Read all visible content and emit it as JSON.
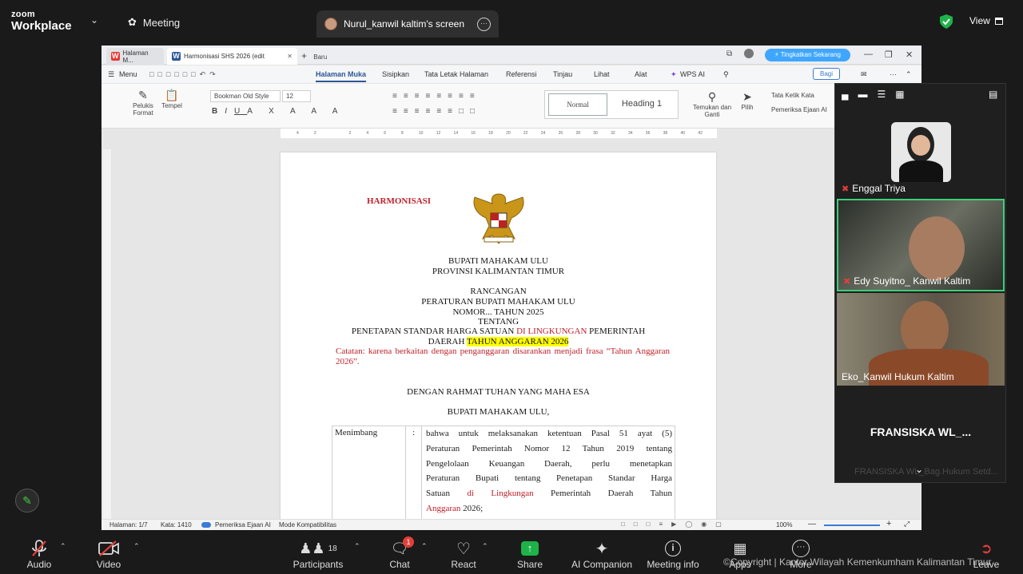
{
  "zoom": {
    "logo_line1": "zoom",
    "logo_line2": "Workplace",
    "meeting_label": "Meeting",
    "share_tab_label": "Nurul_kanwil kaltim's screen",
    "view_label": "View"
  },
  "wps": {
    "tabs": [
      {
        "label": "Halaman M..."
      },
      {
        "label": "Harmonisasi SHS 2026 (edit"
      }
    ],
    "new_tab": "Baru",
    "upgrade": "Tingkatkan Sekarang",
    "menu_label": "Menu",
    "menu_items": [
      "Halaman Muka",
      "Sisipkan",
      "Tata Letak Halaman",
      "Referensi",
      "Tinjau",
      "Lihat",
      "Alat",
      "WPS AI"
    ],
    "share_button": "Bagi",
    "ribbon": {
      "pelukis": "Pelukis",
      "format": "Format",
      "tempel": "Tempel",
      "font": "Bookman Old Style",
      "size": "12",
      "style_normal": "Normal",
      "style_heading": "Heading 1",
      "temukan": "Temukan dan",
      "ganti": "Ganti",
      "pilih": "Pilih",
      "tata_ketik": "Tata Ketik Kata",
      "pemeriksa": "Pemeriksa Ejaan AI"
    },
    "ruler_ticks": [
      "4",
      "2",
      "",
      "2",
      "4",
      "6",
      "8",
      "10",
      "12",
      "14",
      "16",
      "18",
      "20",
      "22",
      "24",
      "26",
      "28",
      "30",
      "32",
      "34",
      "36",
      "38",
      "40",
      "42"
    ],
    "document": {
      "harmonisasi": "HARMONISASI",
      "line1": "BUPATI MAHAKAM ULU",
      "line2": "PROVINSI KALIMANTAN TIMUR",
      "line3": "RANCANGAN",
      "line4": "PERATURAN BUPATI MAHAKAM ULU",
      "line5": "NOMOR... TAHUN 2025",
      "line6": "TENTANG",
      "line7a": "PENETAPAN STANDAR HARGA SATUAN ",
      "line7b": "DI LINGKUNGAN",
      "line7c": " PEMERINTAH",
      "line8a": "DAERAH ",
      "line8b": "TAHUN ANGGARAN",
      "line8c": " 2026",
      "note": "Catatan: karena berkaitan dengan penganggaran disarankan menjadi frasa “Tahun Anggaran 2026”.",
      "line9": "DENGAN RAHMAT TUHAN YANG MAHA ESA",
      "line10": "BUPATI MAHAKAM ULU,",
      "menimbang": "Menimbang",
      "colon": ":",
      "body1": "bahwa untuk melaksanakan ketentuan Pasal 51 ayat (5)",
      "body2": "Peraturan Pemerintah Nomor 12 Tahun 2019 tentang",
      "body3": "Pengelolaan Keuangan Daerah, perlu menetapkan",
      "body4": "Peraturan Bupati tentang Penetapan Standar Harga",
      "body5a": "Satuan ",
      "body5b": "di Lingkungan",
      "body5c": " Pemerintah Daerah Tahun",
      "body6a": "Anggaran",
      "body6b": " 2026;"
    },
    "status": {
      "page": "Halaman: 1/7",
      "words": "Kata: 1410",
      "spell": "Pemeriksa Ejaan AI",
      "mode": "Mode Kompatibilitas",
      "zoom": "100%"
    }
  },
  "participants": [
    {
      "name": "Enggal Triya"
    },
    {
      "name": "Edy Suyitno_ Kanwil Kaltim"
    },
    {
      "name": "Eko_Kanwil Hukum Kaltim"
    },
    {
      "name": "FRANSISKA WL_..."
    },
    {
      "name": "FRANSISKA WL_Bag.Hukum Setd..."
    }
  ],
  "toolbar": {
    "audio": "Audio",
    "video": "Video",
    "participants": "Participants",
    "participants_count": "18",
    "chat": "Chat",
    "chat_badge": "1",
    "react": "React",
    "share": "Share",
    "ai": "AI Companion",
    "info": "Meeting info",
    "apps": "Apps",
    "more": "More",
    "leave": "Leave"
  },
  "watermark": "©Copyright | Kantor Wilayah Kemenkumham Kalimantan Timur",
  "colors": {
    "accent": "#2b5797",
    "red_text": "#c0202a",
    "highlight": "#ffff00",
    "active_border": "#3ccf7a"
  }
}
